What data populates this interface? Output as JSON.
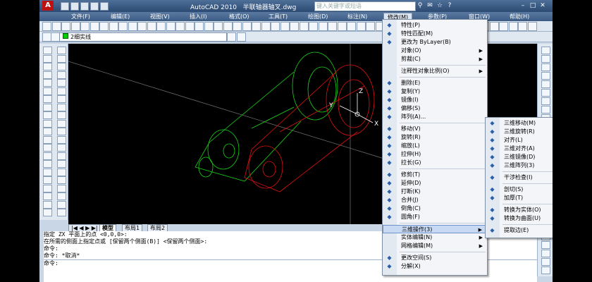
{
  "window": {
    "title": "AutoCAD 2010",
    "filename": "半联轴器轴叉.dwg",
    "search_placeholder": "键入关键字或短语",
    "app_logo": "A"
  },
  "menubar": [
    "文件(F)",
    "编辑(E)",
    "视图(V)",
    "插入(I)",
    "格式(O)",
    "工具(T)",
    "绘图(D)",
    "标注(N)",
    "修改(M)",
    "参数(P)",
    "窗口(W)",
    "帮助(H)"
  ],
  "active_menu": "修改(M)",
  "layer_combo": "2细实线",
  "modify_menu": [
    {
      "label": "特性(P)",
      "icon": "properties-icon"
    },
    {
      "label": "特性匹配(M)",
      "icon": "match-properties-icon"
    },
    {
      "label": "更改为 ByLayer(B)",
      "icon": "bylayer-icon"
    },
    {
      "label": "对象(O)",
      "arrow": true
    },
    {
      "label": "剪裁(C)",
      "arrow": true
    },
    {
      "sep": true
    },
    {
      "label": "注释性对象比例(O)",
      "arrow": true
    },
    {
      "sep": true
    },
    {
      "label": "删除(E)",
      "icon": "erase-icon"
    },
    {
      "label": "复制(Y)",
      "icon": "copy-icon"
    },
    {
      "label": "镜像(I)",
      "icon": "mirror-icon"
    },
    {
      "label": "偏移(S)",
      "icon": "offset-icon"
    },
    {
      "label": "阵列(A)...",
      "icon": "array-icon"
    },
    {
      "sep": true
    },
    {
      "label": "移动(V)",
      "icon": "move-icon"
    },
    {
      "label": "旋转(R)",
      "icon": "rotate-icon"
    },
    {
      "label": "缩放(L)",
      "icon": "scale-icon"
    },
    {
      "label": "拉伸(H)",
      "icon": "stretch-icon"
    },
    {
      "label": "拉长(G)",
      "icon": "lengthen-icon"
    },
    {
      "sep": true
    },
    {
      "label": "修剪(T)",
      "icon": "trim-icon"
    },
    {
      "label": "延伸(D)",
      "icon": "extend-icon"
    },
    {
      "label": "打断(K)",
      "icon": "break-icon"
    },
    {
      "label": "合并(J)",
      "icon": "join-icon"
    },
    {
      "label": "倒角(C)",
      "icon": "chamfer-icon"
    },
    {
      "label": "圆角(F)",
      "icon": "fillet-icon"
    },
    {
      "sep": true
    },
    {
      "label": "三维操作(3)",
      "arrow": true,
      "highlight": true
    },
    {
      "label": "实体编辑(N)",
      "arrow": true
    },
    {
      "label": "网格编辑(M)",
      "arrow": true
    },
    {
      "sep": true
    },
    {
      "label": "更改空间(S)",
      "icon": "change-space-icon"
    },
    {
      "label": "分解(X)",
      "icon": "explode-icon"
    }
  ],
  "submenu_3d": [
    {
      "label": "三维移动(M)",
      "icon": "3d-move-icon"
    },
    {
      "label": "三维旋转(R)",
      "icon": "3d-rotate-icon"
    },
    {
      "label": "对齐(L)",
      "icon": "align-icon"
    },
    {
      "label": "三维对齐(A)",
      "icon": "3d-align-icon"
    },
    {
      "label": "三维镜像(D)",
      "icon": "3d-mirror-icon"
    },
    {
      "label": "三维阵列(3)",
      "icon": "3d-array-icon"
    },
    {
      "sep": true
    },
    {
      "label": "干涉检查(I)",
      "icon": "interference-icon"
    },
    {
      "sep": true
    },
    {
      "label": "剖切(S)",
      "icon": "slice-icon"
    },
    {
      "label": "加厚(T)",
      "icon": "thicken-icon"
    },
    {
      "sep": true
    },
    {
      "label": "转换为实体(O)",
      "icon": "convert-solid-icon"
    },
    {
      "label": "转换为曲面(U)",
      "icon": "convert-surface-icon"
    },
    {
      "sep": true
    },
    {
      "label": "提取边(E)",
      "icon": "extract-edges-icon"
    }
  ],
  "tabs": [
    "模型",
    "布局1",
    "布局2"
  ],
  "command_lines": [
    "指定 ZX 平面上的点 <0,0,0>:",
    "在所需的侧面上指定点或 [保留两个侧面(B)] <保留两个侧面>:",
    "命令:",
    "命令: *取消*",
    "",
    "命令:"
  ],
  "axis_labels": {
    "x": "X",
    "y": "Y",
    "z": "Z"
  },
  "colors": {
    "model_green": "#19d419",
    "model_red": "#e01010",
    "axis_white": "#ffffff"
  }
}
